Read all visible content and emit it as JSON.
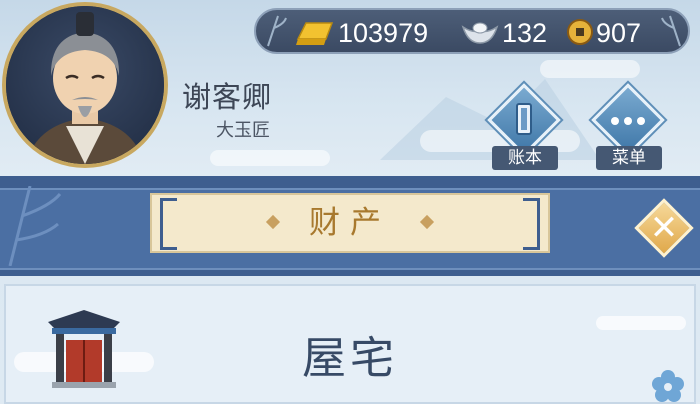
{
  "player": {
    "name": "谢客卿",
    "title": "大玉匠",
    "avatar_icon": "elder-portrait-icon"
  },
  "currency": {
    "gold": "103979",
    "silver": "132",
    "copper": "907",
    "gold_icon": "gold-bar-icon",
    "silver_icon": "silver-ingot-icon",
    "copper_icon": "copper-coin-icon"
  },
  "menu": {
    "ledger_label": "账本",
    "menu_label": "菜单"
  },
  "section": {
    "title": "财产"
  },
  "property": {
    "name": "屋宅",
    "icon": "house-gate-icon"
  },
  "colors": {
    "band": "#4b6fa3",
    "title_text": "#a8792e",
    "plate": "#f4e9cc"
  }
}
